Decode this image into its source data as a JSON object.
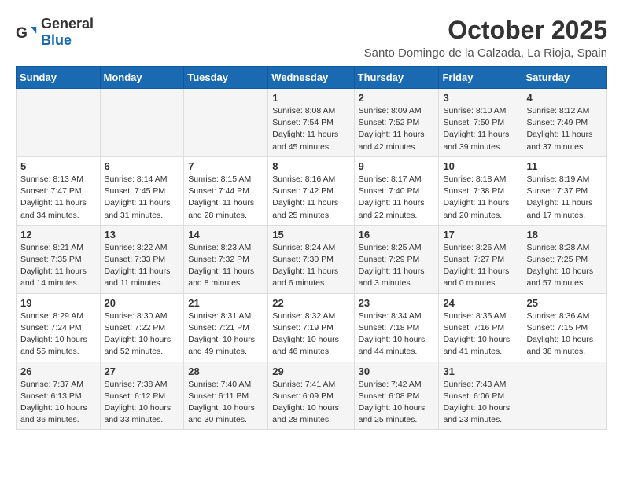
{
  "header": {
    "logo_general": "General",
    "logo_blue": "Blue",
    "month_title": "October 2025",
    "subtitle": "Santo Domingo de la Calzada, La Rioja, Spain"
  },
  "days_of_week": [
    "Sunday",
    "Monday",
    "Tuesday",
    "Wednesday",
    "Thursday",
    "Friday",
    "Saturday"
  ],
  "weeks": [
    [
      {
        "day": "",
        "info": ""
      },
      {
        "day": "",
        "info": ""
      },
      {
        "day": "",
        "info": ""
      },
      {
        "day": "1",
        "info": "Sunrise: 8:08 AM\nSunset: 7:54 PM\nDaylight: 11 hours and 45 minutes."
      },
      {
        "day": "2",
        "info": "Sunrise: 8:09 AM\nSunset: 7:52 PM\nDaylight: 11 hours and 42 minutes."
      },
      {
        "day": "3",
        "info": "Sunrise: 8:10 AM\nSunset: 7:50 PM\nDaylight: 11 hours and 39 minutes."
      },
      {
        "day": "4",
        "info": "Sunrise: 8:12 AM\nSunset: 7:49 PM\nDaylight: 11 hours and 37 minutes."
      }
    ],
    [
      {
        "day": "5",
        "info": "Sunrise: 8:13 AM\nSunset: 7:47 PM\nDaylight: 11 hours and 34 minutes."
      },
      {
        "day": "6",
        "info": "Sunrise: 8:14 AM\nSunset: 7:45 PM\nDaylight: 11 hours and 31 minutes."
      },
      {
        "day": "7",
        "info": "Sunrise: 8:15 AM\nSunset: 7:44 PM\nDaylight: 11 hours and 28 minutes."
      },
      {
        "day": "8",
        "info": "Sunrise: 8:16 AM\nSunset: 7:42 PM\nDaylight: 11 hours and 25 minutes."
      },
      {
        "day": "9",
        "info": "Sunrise: 8:17 AM\nSunset: 7:40 PM\nDaylight: 11 hours and 22 minutes."
      },
      {
        "day": "10",
        "info": "Sunrise: 8:18 AM\nSunset: 7:38 PM\nDaylight: 11 hours and 20 minutes."
      },
      {
        "day": "11",
        "info": "Sunrise: 8:19 AM\nSunset: 7:37 PM\nDaylight: 11 hours and 17 minutes."
      }
    ],
    [
      {
        "day": "12",
        "info": "Sunrise: 8:21 AM\nSunset: 7:35 PM\nDaylight: 11 hours and 14 minutes."
      },
      {
        "day": "13",
        "info": "Sunrise: 8:22 AM\nSunset: 7:33 PM\nDaylight: 11 hours and 11 minutes."
      },
      {
        "day": "14",
        "info": "Sunrise: 8:23 AM\nSunset: 7:32 PM\nDaylight: 11 hours and 8 minutes."
      },
      {
        "day": "15",
        "info": "Sunrise: 8:24 AM\nSunset: 7:30 PM\nDaylight: 11 hours and 6 minutes."
      },
      {
        "day": "16",
        "info": "Sunrise: 8:25 AM\nSunset: 7:29 PM\nDaylight: 11 hours and 3 minutes."
      },
      {
        "day": "17",
        "info": "Sunrise: 8:26 AM\nSunset: 7:27 PM\nDaylight: 11 hours and 0 minutes."
      },
      {
        "day": "18",
        "info": "Sunrise: 8:28 AM\nSunset: 7:25 PM\nDaylight: 10 hours and 57 minutes."
      }
    ],
    [
      {
        "day": "19",
        "info": "Sunrise: 8:29 AM\nSunset: 7:24 PM\nDaylight: 10 hours and 55 minutes."
      },
      {
        "day": "20",
        "info": "Sunrise: 8:30 AM\nSunset: 7:22 PM\nDaylight: 10 hours and 52 minutes."
      },
      {
        "day": "21",
        "info": "Sunrise: 8:31 AM\nSunset: 7:21 PM\nDaylight: 10 hours and 49 minutes."
      },
      {
        "day": "22",
        "info": "Sunrise: 8:32 AM\nSunset: 7:19 PM\nDaylight: 10 hours and 46 minutes."
      },
      {
        "day": "23",
        "info": "Sunrise: 8:34 AM\nSunset: 7:18 PM\nDaylight: 10 hours and 44 minutes."
      },
      {
        "day": "24",
        "info": "Sunrise: 8:35 AM\nSunset: 7:16 PM\nDaylight: 10 hours and 41 minutes."
      },
      {
        "day": "25",
        "info": "Sunrise: 8:36 AM\nSunset: 7:15 PM\nDaylight: 10 hours and 38 minutes."
      }
    ],
    [
      {
        "day": "26",
        "info": "Sunrise: 7:37 AM\nSunset: 6:13 PM\nDaylight: 10 hours and 36 minutes."
      },
      {
        "day": "27",
        "info": "Sunrise: 7:38 AM\nSunset: 6:12 PM\nDaylight: 10 hours and 33 minutes."
      },
      {
        "day": "28",
        "info": "Sunrise: 7:40 AM\nSunset: 6:11 PM\nDaylight: 10 hours and 30 minutes."
      },
      {
        "day": "29",
        "info": "Sunrise: 7:41 AM\nSunset: 6:09 PM\nDaylight: 10 hours and 28 minutes."
      },
      {
        "day": "30",
        "info": "Sunrise: 7:42 AM\nSunset: 6:08 PM\nDaylight: 10 hours and 25 minutes."
      },
      {
        "day": "31",
        "info": "Sunrise: 7:43 AM\nSunset: 6:06 PM\nDaylight: 10 hours and 23 minutes."
      },
      {
        "day": "",
        "info": ""
      }
    ]
  ]
}
